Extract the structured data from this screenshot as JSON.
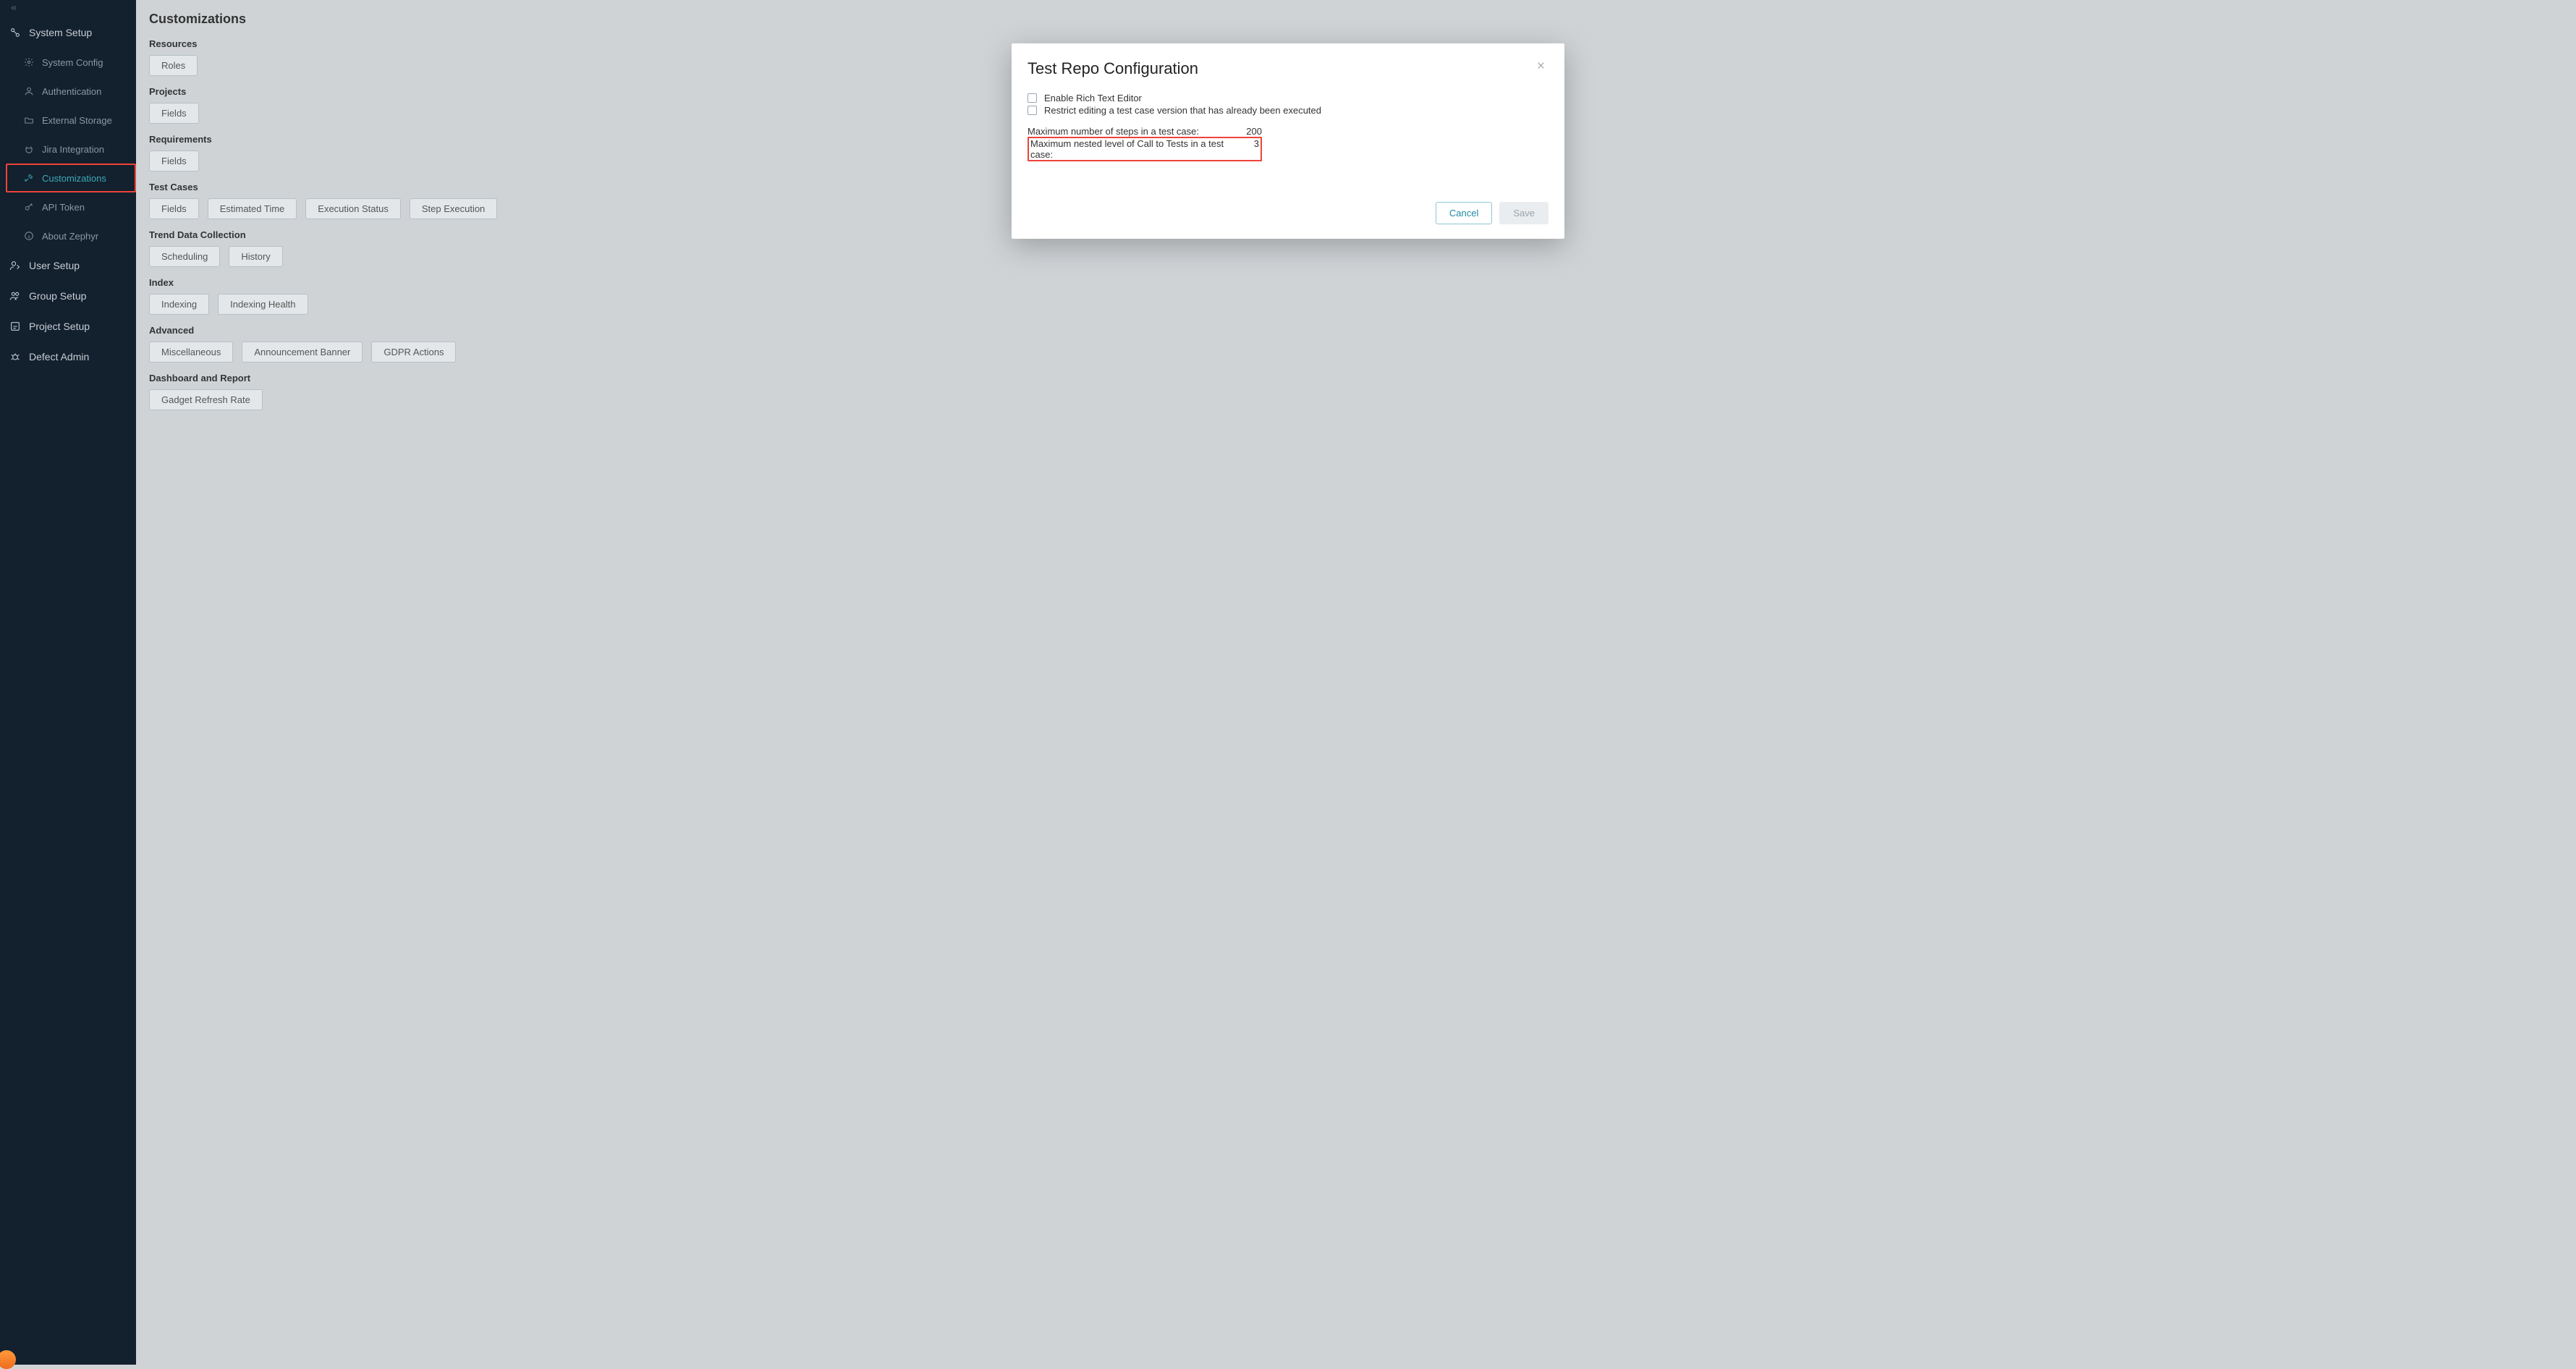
{
  "page": {
    "title": "Customizations"
  },
  "sidebar": {
    "groups": [
      {
        "label": "System Setup",
        "items": [
          {
            "label": "System Config"
          },
          {
            "label": "Authentication"
          },
          {
            "label": "External Storage"
          },
          {
            "label": "Jira Integration"
          },
          {
            "label": "Customizations"
          },
          {
            "label": "API Token"
          },
          {
            "label": "About Zephyr"
          }
        ]
      },
      {
        "label": "User Setup"
      },
      {
        "label": "Group Setup"
      },
      {
        "label": "Project Setup"
      },
      {
        "label": "Defect Admin"
      }
    ]
  },
  "sections": [
    {
      "title": "Resources",
      "buttons": [
        "Roles"
      ]
    },
    {
      "title": "Projects",
      "buttons": [
        "Fields"
      ]
    },
    {
      "title": "Requirements",
      "buttons": [
        "Fields"
      ]
    },
    {
      "title": "Test Cases",
      "buttons": [
        "Fields",
        "Estimated Time",
        "Execution Status",
        "Step Execution"
      ]
    },
    {
      "title": "Trend Data Collection",
      "buttons": [
        "Scheduling",
        "History"
      ]
    },
    {
      "title": "Index",
      "buttons": [
        "Indexing",
        "Indexing Health"
      ]
    },
    {
      "title": "Advanced",
      "buttons": [
        "Miscellaneous",
        "Announcement Banner",
        "GDPR Actions"
      ]
    },
    {
      "title": "Dashboard and Report",
      "buttons": [
        "Gadget Refresh Rate"
      ]
    }
  ],
  "modal": {
    "title": "Test Repo Configuration",
    "check1": "Enable Rich Text Editor",
    "check2": "Restrict editing a test case version that has already been executed",
    "row1_label": "Maximum number of steps in a test case:",
    "row1_value": "200",
    "row2_label": "Maximum nested level of Call to Tests in a test case:",
    "row2_value": "3",
    "cancel": "Cancel",
    "save": "Save"
  }
}
